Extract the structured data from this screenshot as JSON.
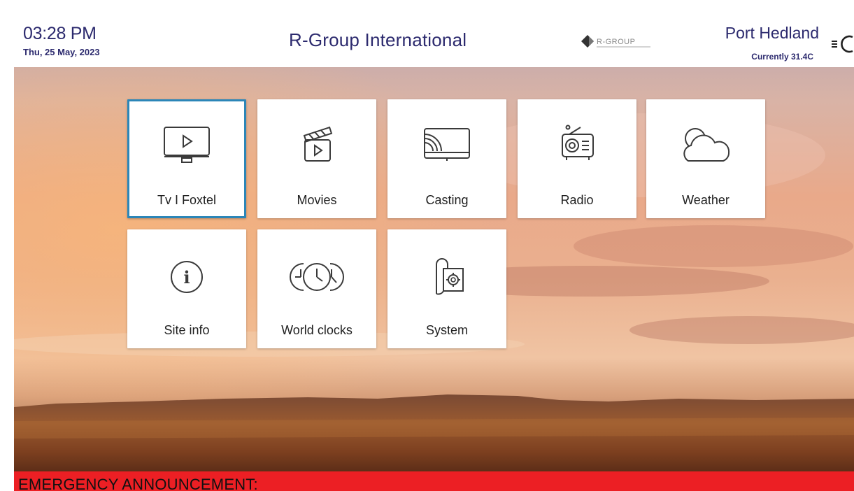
{
  "header": {
    "time": "03:28 PM",
    "date": "Thu, 25 May, 2023",
    "title": "R-Group International",
    "logo_text": "R-GROUP",
    "location": "Port Hedland",
    "temperature": "Currently 31.4C"
  },
  "tiles": [
    {
      "label": "Tv I Foxtel",
      "icon": "tv-icon",
      "selected": true
    },
    {
      "label": "Movies",
      "icon": "clapperboard-icon",
      "selected": false
    },
    {
      "label": "Casting",
      "icon": "cast-icon",
      "selected": false
    },
    {
      "label": "Radio",
      "icon": "radio-icon",
      "selected": false
    },
    {
      "label": "Weather",
      "icon": "cloud-icon",
      "selected": false
    },
    {
      "label": "Site info",
      "icon": "info-icon",
      "selected": false
    },
    {
      "label": "World clocks",
      "icon": "world-clocks-icon",
      "selected": false
    },
    {
      "label": "System",
      "icon": "system-settings-icon",
      "selected": false
    }
  ],
  "emergency": {
    "text": "EMERGENCY ANNOUNCEMENT:"
  },
  "colors": {
    "text_primary": "#2c2a6e",
    "selected_border": "#2b86b8",
    "emergency_bar": "#ec1f24"
  }
}
